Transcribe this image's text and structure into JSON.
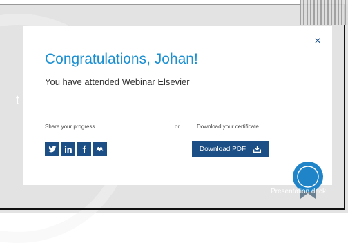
{
  "modal": {
    "title": "Congratulations, Johan!",
    "subtitle": "You have attended Webinar Elsevier",
    "close_icon": "close-icon",
    "share_label": "Share your progress",
    "or_label": "or",
    "download_label": "Download your certificate",
    "download_button_label": "Download PDF",
    "social_icons": [
      "twitter-icon",
      "linkedin-icon",
      "facebook-icon",
      "mendeley-icon"
    ]
  },
  "background": {
    "partial_left_text": "t",
    "partial_bottom_text": "Presentation deck"
  },
  "colors": {
    "accent": "#1a8fd1",
    "brand_dark": "#1b4f86",
    "badge_blue": "#1f84c8"
  }
}
